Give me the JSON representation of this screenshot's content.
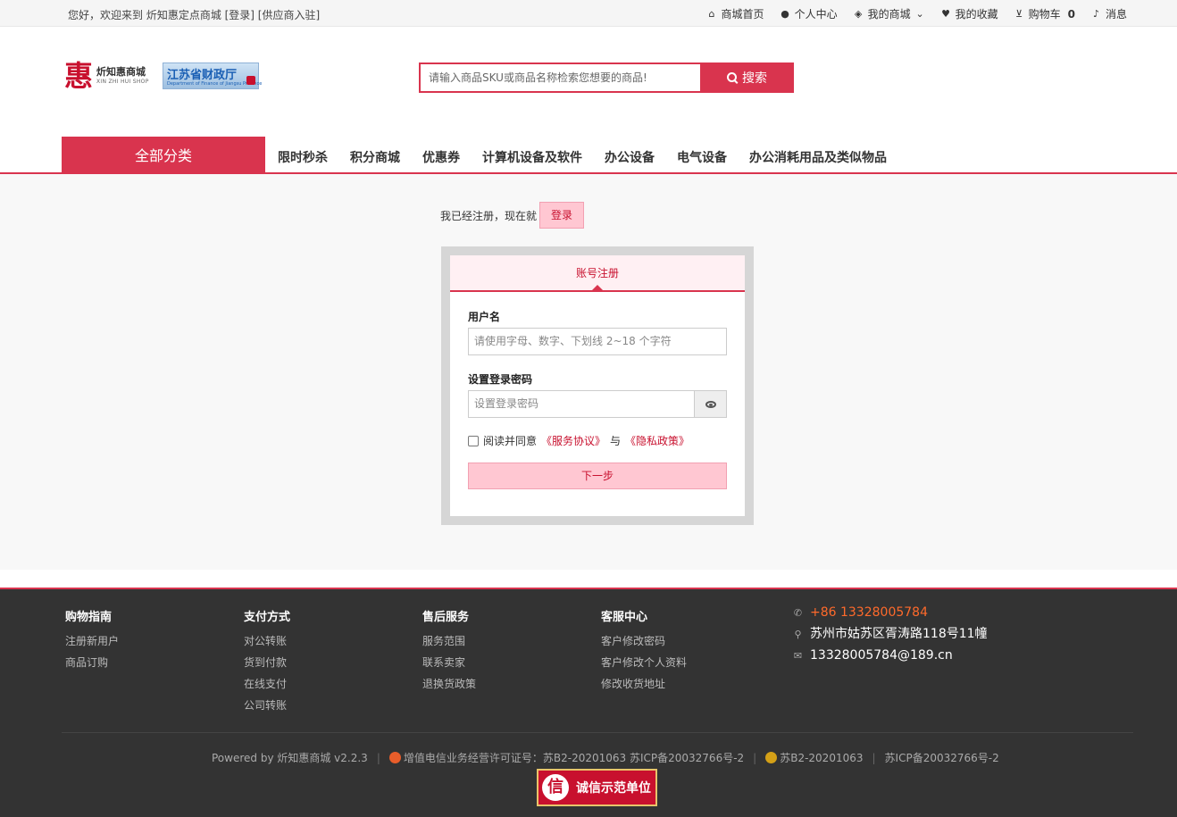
{
  "topbar": {
    "welcome": "您好，欢迎来到 炘知惠定点商城 [登录] [供应商入驻]",
    "links": [
      {
        "icon": "home-icon",
        "label": "商城首页"
      },
      {
        "icon": "user-icon",
        "label": "个人中心"
      },
      {
        "icon": "box-icon",
        "label": "我的商城"
      },
      {
        "icon": "heart-icon",
        "label": "我的收藏"
      },
      {
        "icon": "cart-icon",
        "label": "购物车"
      },
      {
        "icon": "bell-icon",
        "label": "消息"
      }
    ],
    "cart_count": "0"
  },
  "logo": {
    "brand_cn": "炘知惠商城",
    "brand_en": "XIN ZHI HUI SHOP",
    "dept_cn": "江苏省财政厅",
    "dept_en": "Department of Finance of Jiangsu Province"
  },
  "search": {
    "placeholder": "请输入商品SKU或商品名称检索您想要的商品!",
    "button": "搜索"
  },
  "nav": {
    "all_categories": "全部分类",
    "items": [
      "限时秒杀",
      "积分商城",
      "优惠券",
      "计算机设备及软件",
      "办公设备",
      "电气设备",
      "办公消耗用品及类似物品"
    ]
  },
  "main": {
    "already_text": "我已经注册，现在就",
    "login_button": "登录",
    "tab": "账号注册",
    "username_label": "用户名",
    "username_placeholder": "请使用字母、数字、下划线 2~18 个字符",
    "password_label": "设置登录密码",
    "password_placeholder": "设置登录密码",
    "agree_text": "阅读并同意",
    "service_link": "《服务协议》",
    "and_text": "与",
    "privacy_link": "《隐私政策》",
    "next_button": "下一步"
  },
  "footer": {
    "columns": [
      {
        "title": "购物指南",
        "items": [
          "注册新用户",
          "商品订购"
        ]
      },
      {
        "title": "支付方式",
        "items": [
          "对公转账",
          "货到付款",
          "在线支付",
          "公司转账"
        ]
      },
      {
        "title": "售后服务",
        "items": [
          "服务范围",
          "联系卖家",
          "退换货政策"
        ]
      },
      {
        "title": "客服中心",
        "items": [
          "客户修改密码",
          "客户修改个人资料",
          "修改收货地址"
        ]
      }
    ],
    "phone": "+86 13328005784",
    "address": "苏州市姑苏区胥涛路118号11幢",
    "email": "13328005784@189.cn",
    "powered": "Powered by 炘知惠商城 v2.2.3",
    "license": "增值电信业务经营许可证号：苏B2-20201063 苏ICP备20032766号-2",
    "police": "苏B2-20201063",
    "icp": "苏ICP备20032766号-2",
    "credit_badge": "诚信示范单位",
    "credit_char": "信"
  }
}
